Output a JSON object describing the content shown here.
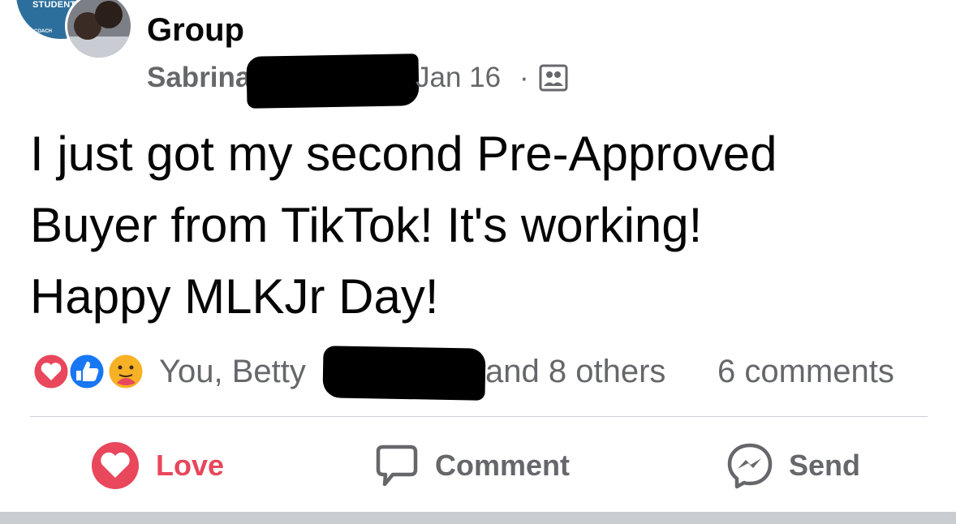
{
  "header": {
    "group_avatar_text_top": "STUDENT",
    "group_avatar_text_bottom": "COACH",
    "group_name": "Group",
    "author_visible": "Sabrina",
    "date": "Jan 16",
    "separator": "·",
    "audience_icon": "group-members-icon"
  },
  "post": {
    "text": "I just got my second Pre-Approved\nBuyer from TikTok! It's working!\nHappy MLKJr Day!"
  },
  "reactions": {
    "icons": [
      "love-reaction-icon",
      "like-reaction-icon",
      "care-reaction-icon"
    ],
    "reactors_prefix": "You, Betty",
    "reactors_suffix": "and 8 others",
    "comments_count": "6 comments"
  },
  "actions": {
    "love_label": "Love",
    "comment_label": "Comment",
    "send_label": "Send"
  },
  "colors": {
    "love_red": "#e8475c",
    "like_blue": "#1877f2",
    "secondary_text": "#65676b",
    "divider": "#ced0d4"
  }
}
